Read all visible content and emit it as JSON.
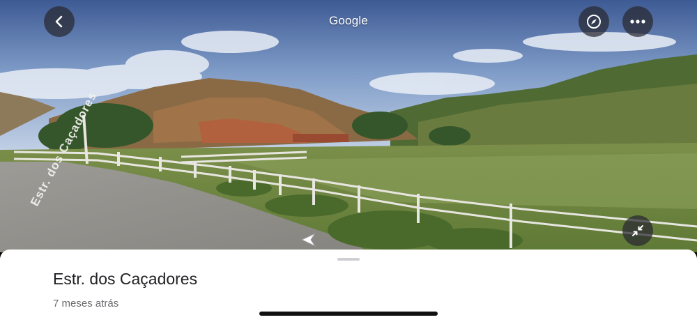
{
  "header": {
    "title": "Google",
    "back_icon": "chevron-left-icon",
    "compass_icon": "compass-icon",
    "more_icon": "more-horizontal-icon"
  },
  "street_view": {
    "road_marking_text": "Estr. dos Caçadores",
    "nav_arrow_icon": "navigation-arrow-icon",
    "collapse_icon": "collapse-arrows-icon"
  },
  "bottom_sheet": {
    "place_name": "Estr. dos Caçadores",
    "date": "7 meses atrás"
  },
  "colors": {
    "button_bg": "#28283080",
    "sheet_bg": "#ffffff",
    "text_primary": "#202124",
    "text_secondary": "#6b6b70"
  }
}
